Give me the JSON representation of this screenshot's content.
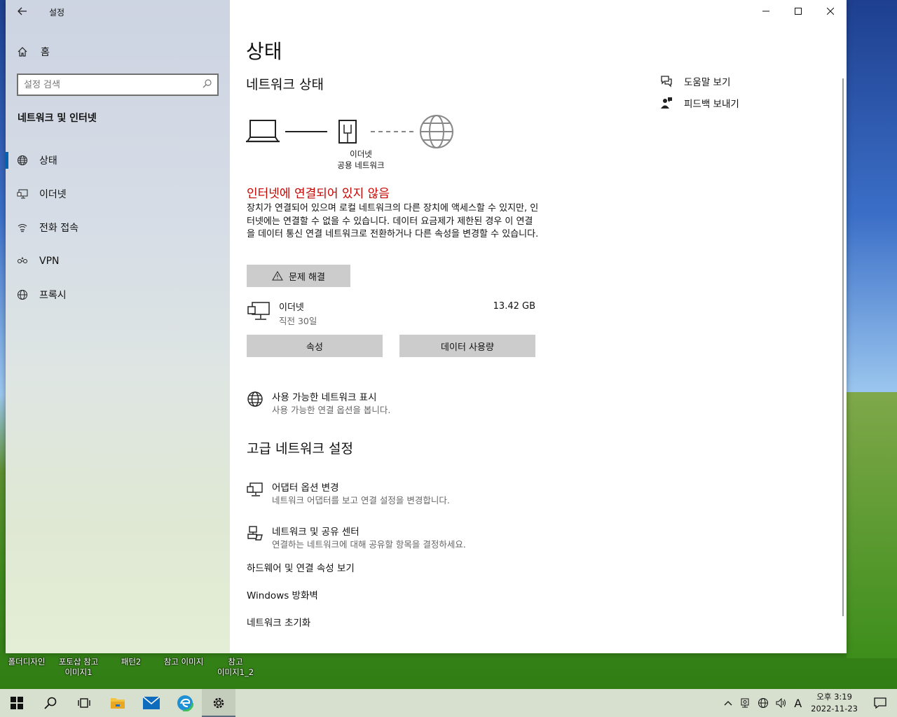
{
  "window": {
    "app_title": "설정",
    "controls": {
      "minimize": "—",
      "maximize": "☐",
      "close": "✕"
    }
  },
  "sidebar": {
    "home_label": "홈",
    "search_placeholder": "설정 검색",
    "section_title": "네트워크 및 인터넷",
    "items": [
      {
        "label": "상태",
        "icon": "globe-icon",
        "active": true
      },
      {
        "label": "이더넷",
        "icon": "ethernet-icon",
        "active": false
      },
      {
        "label": "전화 접속",
        "icon": "dialup-icon",
        "active": false
      },
      {
        "label": "VPN",
        "icon": "vpn-icon",
        "active": false
      },
      {
        "label": "프록시",
        "icon": "globe-icon",
        "active": false
      }
    ]
  },
  "main": {
    "page_title": "상태",
    "network_status_title": "네트워크 상태",
    "diagram_label_line1": "이더넷",
    "diagram_label_line2": "공용 네트워크",
    "status_error": "인터넷에 연결되어 있지 않음",
    "status_desc": "장치가 연결되어 있으며 로컬 네트워크의 다른 장치에 액세스할 수 있지만, 인터넷에는 연결할 수 없을 수 있습니다. 데이터 요금제가 제한된 경우 이 연결을 데이터 통신 연결 네트워크로 전환하거나 다른 속성을 변경할 수 있습니다.",
    "troubleshoot_label": "문제 해결",
    "ethernet": {
      "name": "이더넷",
      "sub": "직전 30일",
      "size": "13.42 GB"
    },
    "properties_label": "속성",
    "data_usage_label": "데이터 사용량",
    "show_networks": {
      "title": "사용 가능한 네트워크 표시",
      "sub": "사용 가능한 연결 옵션을 봅니다."
    },
    "advanced_title": "고급 네트워크 설정",
    "adapter_options": {
      "title": "어댑터 옵션 변경",
      "sub": "네트워크 어댑터를 보고 연결 설정을 변경합니다."
    },
    "sharing_center": {
      "title": "네트워크 및 공유 센터",
      "sub": "연결하는 네트워크에 대해 공유할 항목을 결정하세요."
    },
    "hw_props_link": "하드웨어 및 연결 속성 보기",
    "firewall_link": "Windows 방화벽",
    "reset_link": "네트워크 초기화"
  },
  "help": {
    "help_label": "도움말 보기",
    "feedback_label": "피드백 보내기"
  },
  "desktop_icons": [
    {
      "line1": "폴더디자인",
      "line2": ""
    },
    {
      "line1": "포토샵 참고",
      "line2": "이미지1"
    },
    {
      "line1": "패턴2",
      "line2": ""
    },
    {
      "line1": "참고 이미지",
      "line2": ""
    },
    {
      "line1": "참고",
      "line2": "이미지1_2"
    }
  ],
  "taskbar": {
    "ime_label": "A",
    "clock_time": "오후 3:19",
    "clock_date": "2022-11-23"
  }
}
